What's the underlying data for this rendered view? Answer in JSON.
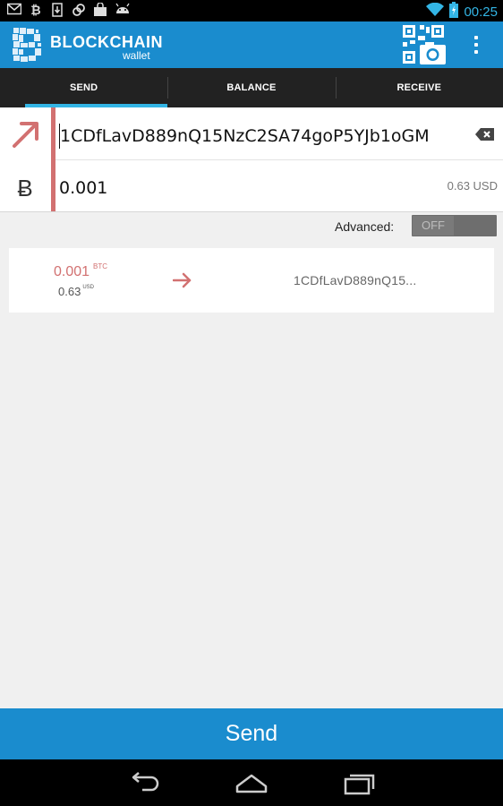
{
  "status_bar": {
    "time": "00:25",
    "icons": [
      "gmail-icon",
      "bitcoin-icon",
      "sim-download-icon",
      "sync-icon",
      "shopping-bag-icon",
      "android-icon"
    ]
  },
  "app": {
    "brand": "BLOCKCHAIN",
    "brand_sub": "wallet",
    "accent_color": "#1a8cce"
  },
  "tabs": [
    {
      "label": "SEND",
      "active": true
    },
    {
      "label": "BALANCE",
      "active": false
    },
    {
      "label": "RECEIVE",
      "active": false
    }
  ],
  "form": {
    "address_value": "1CDfLavD889nQ15NzC2SA74goP5YJb1oGM",
    "amount_value": "0.001",
    "usd_value": "0.63 USD"
  },
  "advanced": {
    "label": "Advanced:",
    "toggle_state": "OFF"
  },
  "preview": {
    "btc_amount": "0.001",
    "btc_unit": "BTC",
    "usd_amount": "0.63",
    "usd_unit": "USD",
    "address": "1CDfLavD889nQ15..."
  },
  "send_button": "Send",
  "colors": {
    "accent": "#1a8cce",
    "send_red": "#d27171",
    "tab_indicator": "#33b5e5"
  }
}
